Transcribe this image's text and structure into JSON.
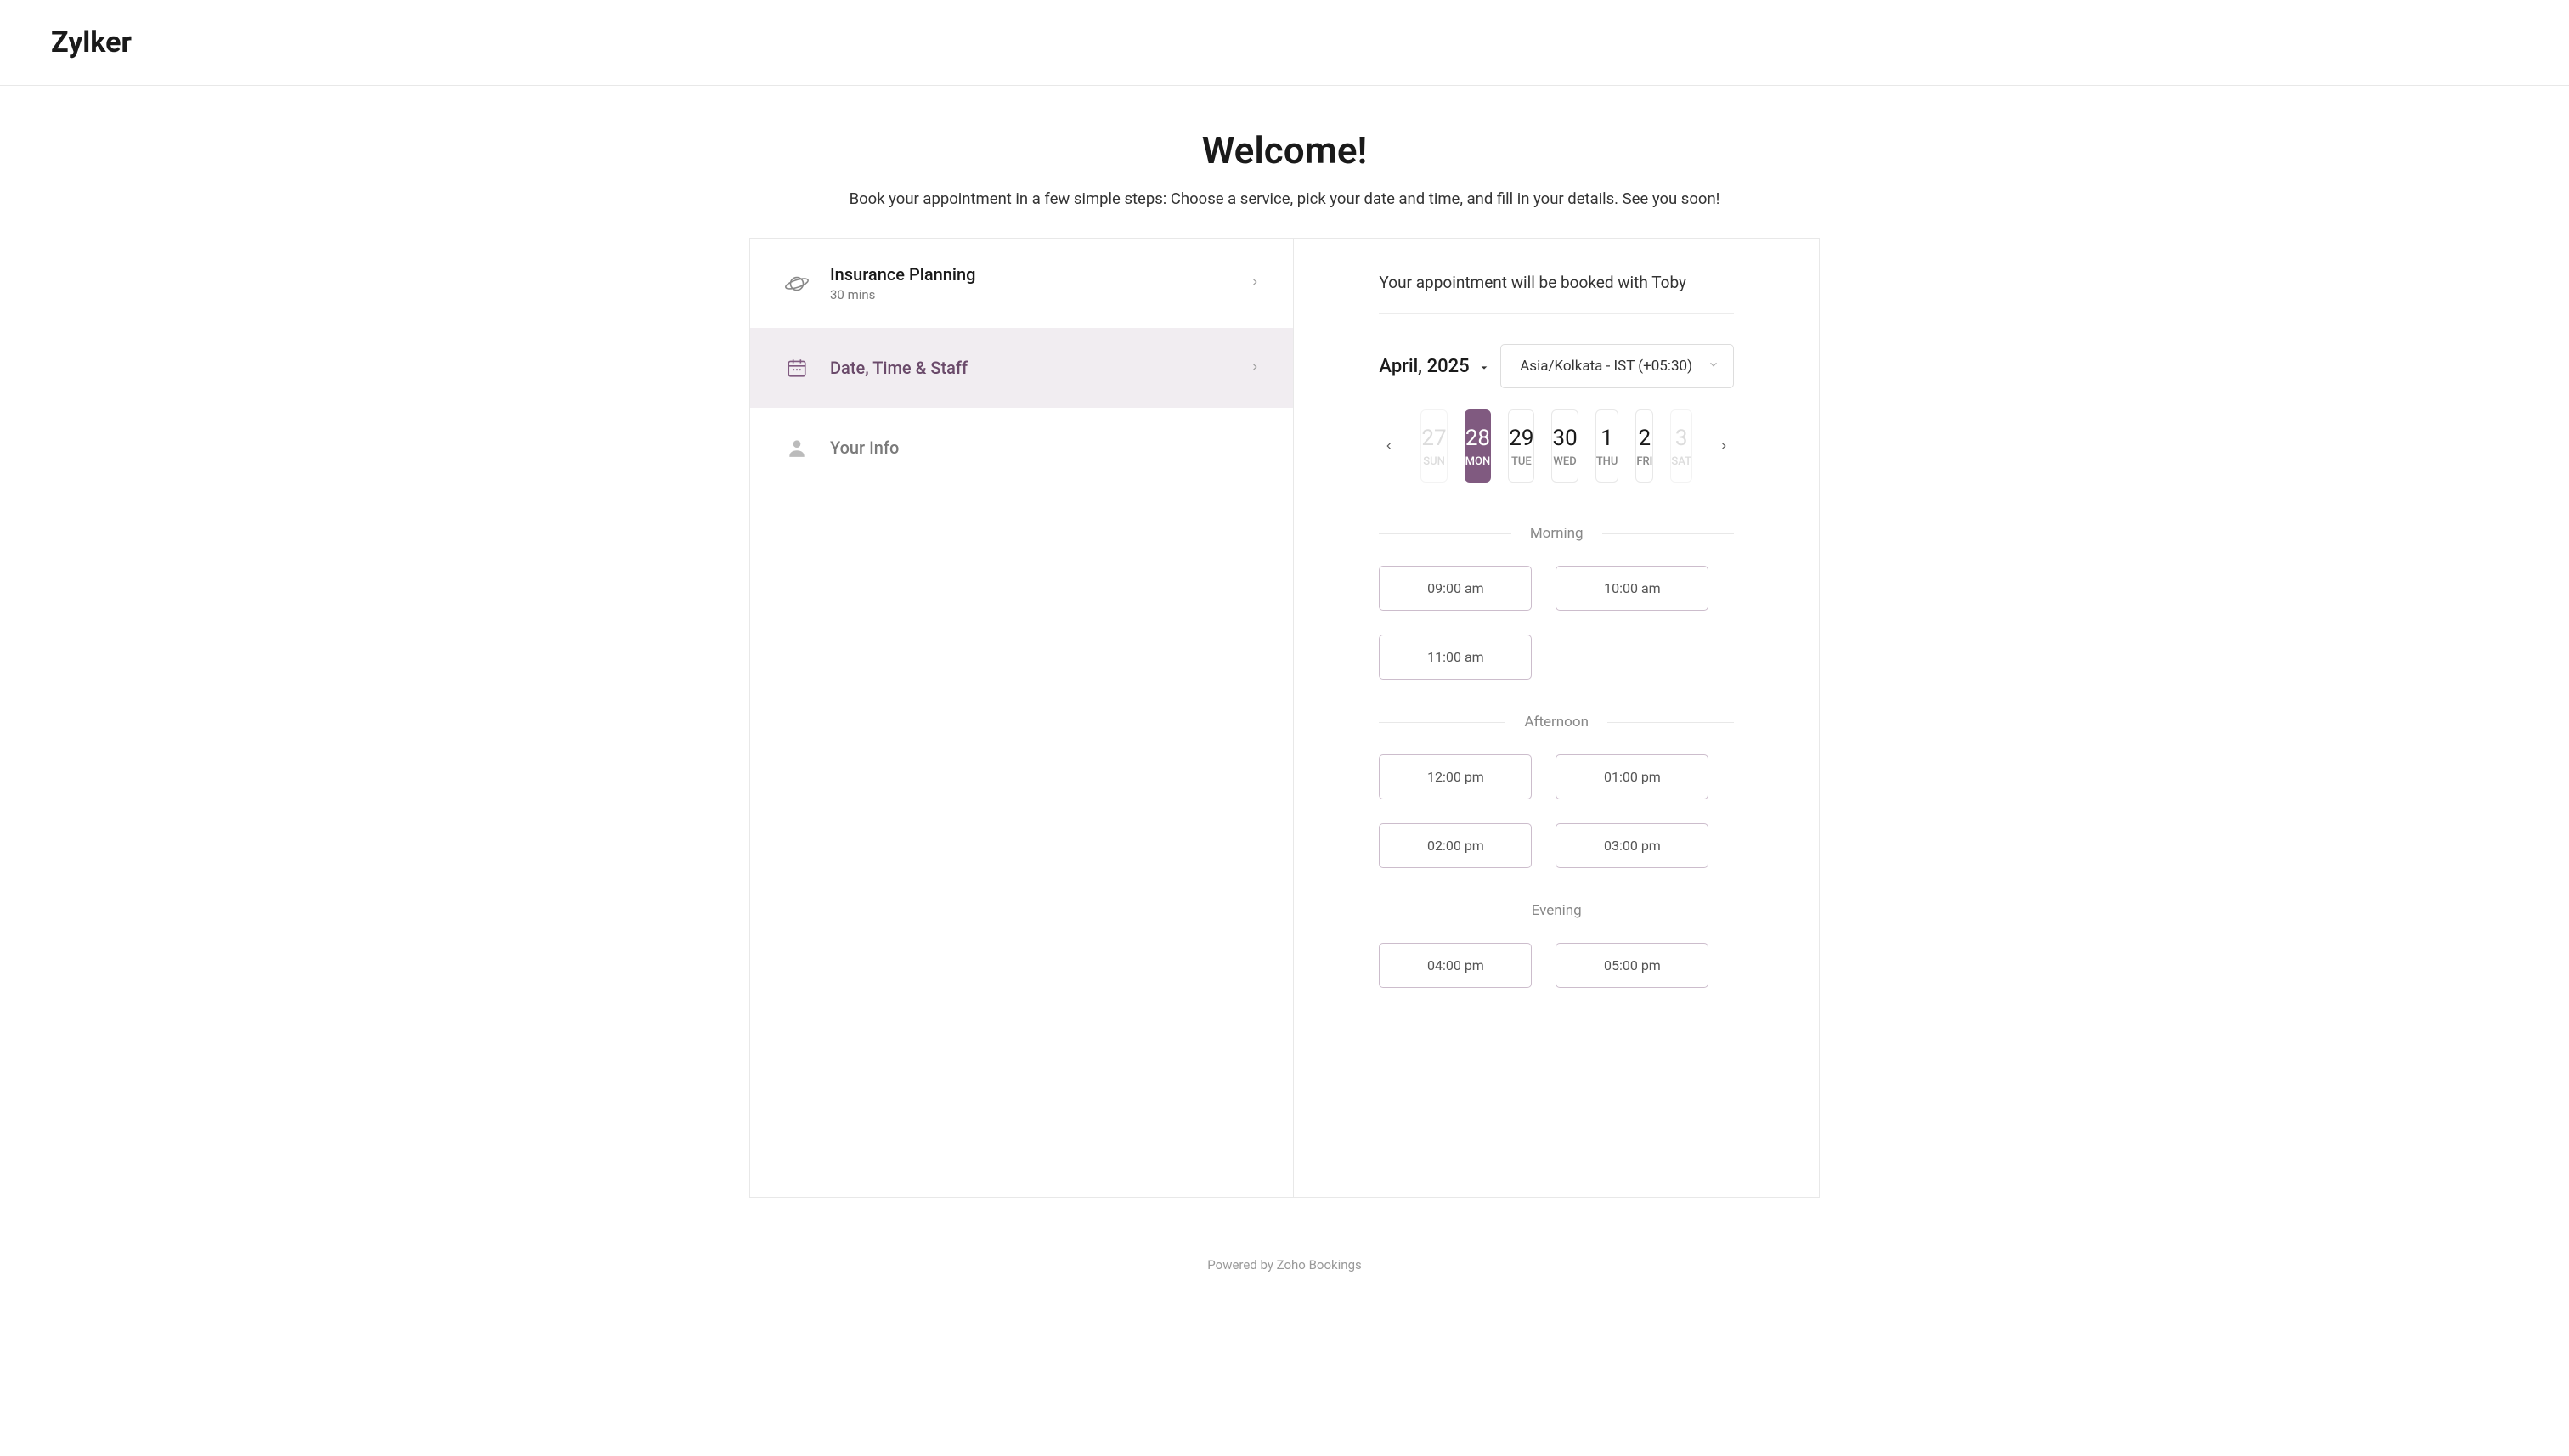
{
  "brand": "Zylker",
  "hero": {
    "title": "Welcome!",
    "subtitle": "Book your appointment in a few simple steps: Choose a service, pick your date and time, and fill in your details. See you soon!"
  },
  "steps": {
    "service": {
      "title": "Insurance Planning",
      "sub": "30 mins"
    },
    "datetime": {
      "title": "Date, Time & Staff"
    },
    "info": {
      "title": "Your Info"
    }
  },
  "schedule": {
    "booked_with": "Your appointment will be booked with Toby",
    "month": "April, 2025",
    "timezone": "Asia/Kolkata - IST (+05:30)",
    "dates": [
      {
        "num": "27",
        "day": "SUN",
        "state": "disabled"
      },
      {
        "num": "28",
        "day": "MON",
        "state": "selected"
      },
      {
        "num": "29",
        "day": "TUE",
        "state": "normal"
      },
      {
        "num": "30",
        "day": "WED",
        "state": "normal"
      },
      {
        "num": "1",
        "day": "THU",
        "state": "normal"
      },
      {
        "num": "2",
        "day": "FRI",
        "state": "normal"
      },
      {
        "num": "3",
        "day": "SAT",
        "state": "disabled"
      }
    ],
    "sections": [
      {
        "label": "Morning",
        "slots": [
          "09:00 am",
          "10:00 am",
          "11:00 am"
        ]
      },
      {
        "label": "Afternoon",
        "slots": [
          "12:00 pm",
          "01:00 pm",
          "02:00 pm",
          "03:00 pm"
        ]
      },
      {
        "label": "Evening",
        "slots": [
          "04:00 pm",
          "05:00 pm"
        ]
      }
    ]
  },
  "footer": "Powered by Zoho Bookings"
}
